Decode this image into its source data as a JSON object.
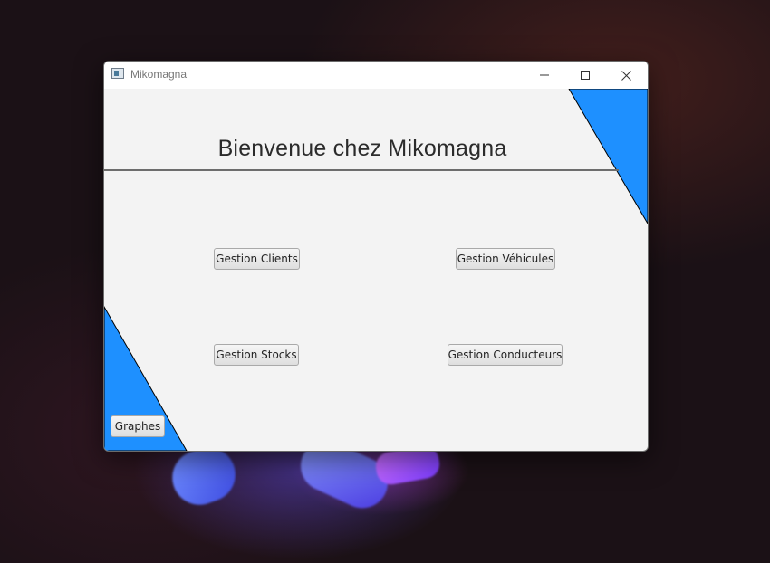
{
  "window": {
    "title": "Mikomagna",
    "controls": {
      "minimize": "minimize-icon",
      "maximize": "maximize-icon",
      "close": "close-icon"
    }
  },
  "main": {
    "heading": "Bienvenue chez Mikomagna",
    "buttons": {
      "clients": "Gestion Clients",
      "vehicules": "Gestion Véhicules",
      "stocks": "Gestion Stocks",
      "conducteurs": "Gestion Conducteurs",
      "graphes": "Graphes"
    }
  },
  "colors": {
    "accent": "#1e90ff",
    "panel_background": "#f3f3f3",
    "divider": "#6d6d6d"
  }
}
